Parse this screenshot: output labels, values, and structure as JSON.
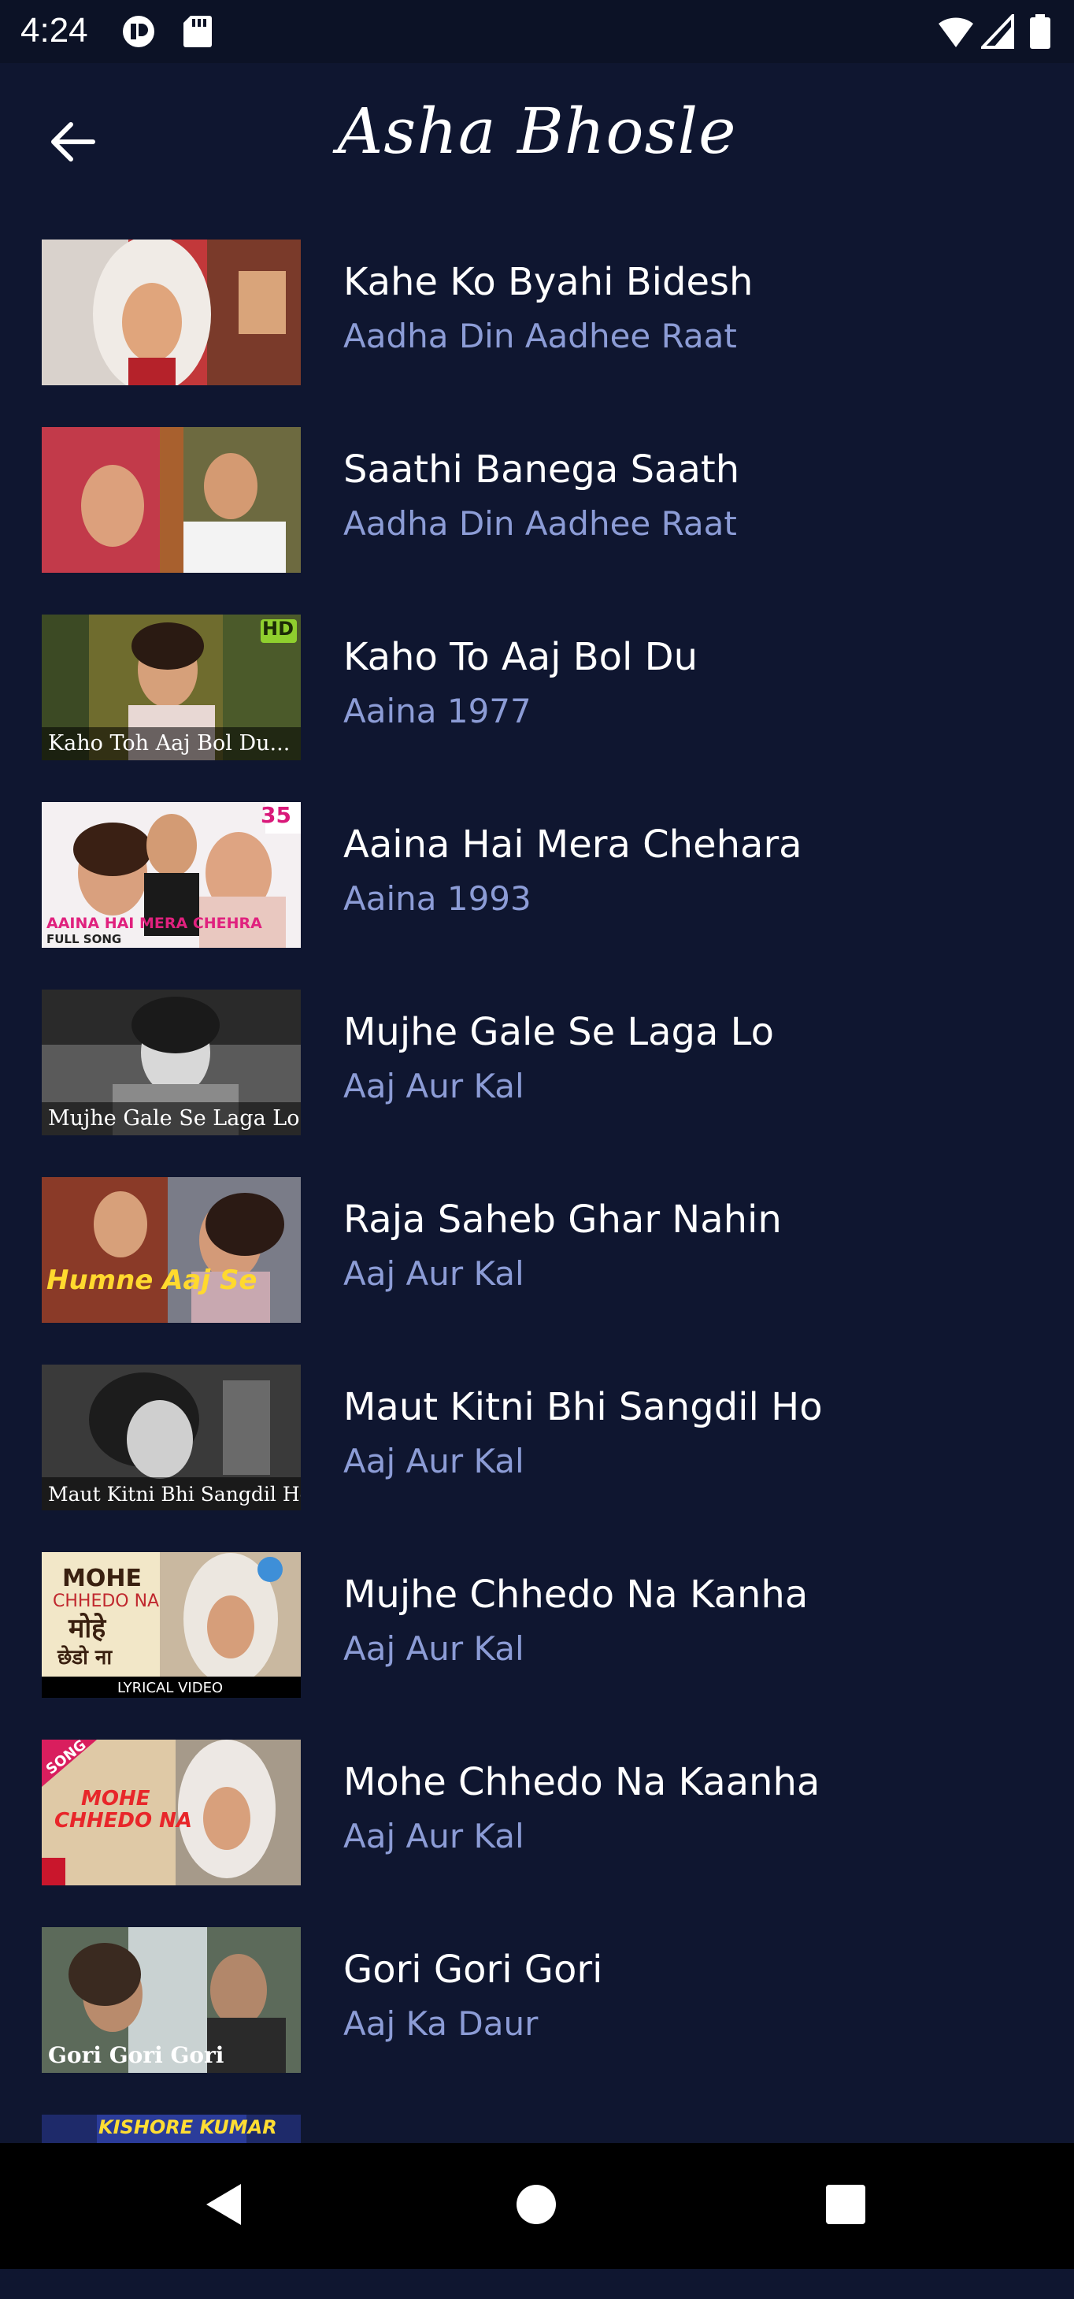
{
  "status_bar": {
    "time": "4:24",
    "icons": [
      "media-icon",
      "sd-card-icon",
      "wifi-icon",
      "signal-icon",
      "battery-icon"
    ]
  },
  "app_bar": {
    "title": "Asha Bhosle",
    "back_icon": "arrow-left-icon"
  },
  "songs": [
    {
      "title": "Kahe Ko Byahi Bidesh",
      "subtitle": "Aadha Din Aadhee Raat",
      "thumb_caption": ""
    },
    {
      "title": "Saathi Banega Saath",
      "subtitle": "Aadha Din Aadhee Raat",
      "thumb_caption": ""
    },
    {
      "title": "Kaho To Aaj Bol Du",
      "subtitle": "Aaina 1977",
      "thumb_caption": "Kaho Toh Aaj Bol Du...",
      "badge": "HD"
    },
    {
      "title": "Aaina Hai Mera Chehara",
      "subtitle": "Aaina 1993",
      "thumb_caption": "AAINA HAI MERA CHEHRA",
      "thumb_caption_2": "FULL SONG",
      "badge": "35"
    },
    {
      "title": "Mujhe Gale Se Laga Lo",
      "subtitle": "Aaj Aur Kal",
      "thumb_caption": "Mujhe Gale Se Laga Lo..."
    },
    {
      "title": "Raja Saheb Ghar Nahin",
      "subtitle": "Aaj Aur Kal",
      "thumb_caption": "Humne Aaj Se"
    },
    {
      "title": "Maut Kitni Bhi Sangdil Ho",
      "subtitle": "Aaj Aur Kal",
      "thumb_caption": "Maut Kitni Bhi Sangdil Ho..."
    },
    {
      "title": "Mujhe Chhedo Na Kanha",
      "subtitle": "Aaj Aur Kal",
      "thumb_caption": "MOHE",
      "thumb_caption_2": "CHHEDO NA",
      "thumb_caption_3": "मोहे",
      "thumb_caption_4": "छेडो ना",
      "thumb_caption_5": "LYRICAL VIDEO"
    },
    {
      "title": "Mohe Chhedo Na Kaanha",
      "subtitle": "Aaj Aur Kal",
      "thumb_caption": "MOHE",
      "thumb_caption_2": "CHHEDO NA",
      "badge": "SONG"
    },
    {
      "title": "Gori Gori Gori",
      "subtitle": "Aaj Ka Daur",
      "thumb_caption": "Gori Gori Gori"
    },
    {
      "title": "",
      "subtitle": "",
      "thumb_caption": "KISHORE KUMAR"
    }
  ],
  "nav_bar": {
    "back": "back-triangle-icon",
    "home": "home-circle-icon",
    "recents": "recents-square-icon"
  },
  "colors": {
    "background": "#0f1630",
    "title": "#ffffff",
    "subtitle": "#8c9cd6",
    "nav_bar": "#000000"
  }
}
